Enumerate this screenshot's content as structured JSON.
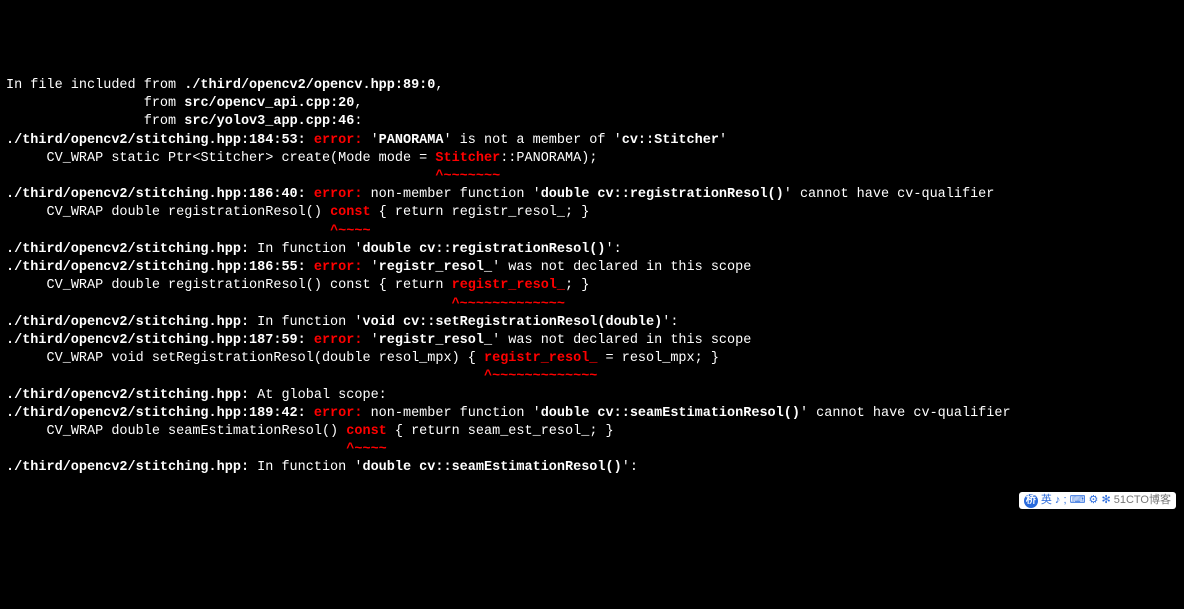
{
  "terminal": {
    "include_header": {
      "l1_a": "In file included from ",
      "l1_b": "./third/opencv2/opencv.hpp:89:0",
      "l1_c": ",",
      "l2_a": "                 from ",
      "l2_b": "src/opencv_api.cpp:20",
      "l2_c": ",",
      "l3_a": "                 from ",
      "l3_b": "src/yolov3_app.cpp:46",
      "l3_c": ":"
    },
    "err1": {
      "loc": "./third/opencv2/stitching.hpp:184:53:",
      "tag": " error: ",
      "m1": "'",
      "m2": "PANORAMA",
      "m3": "' is not a member of '",
      "m4": "cv::Stitcher",
      "m5": "'",
      "code_a": "     CV_WRAP static Ptr<Stitcher> create(Mode mode = ",
      "code_b": "Stitcher",
      "code_c": "::PANORAMA);",
      "caret": "                                                     ^~~~~~~~"
    },
    "err2": {
      "loc": "./third/opencv2/stitching.hpp:186:40:",
      "tag": " error: ",
      "m1": "non-member function '",
      "m2": "double cv::registrationResol()",
      "m3": "' cannot have cv-qualifier",
      "code_a": "     CV_WRAP double registrationResol() ",
      "code_b": "const",
      "code_c": " { return registr_resol_; }",
      "caret": "                                        ^~~~~"
    },
    "ctx1": {
      "loc": "./third/opencv2/stitching.hpp:",
      "m1": " In function '",
      "m2": "double cv::registrationResol()",
      "m3": "':"
    },
    "err3": {
      "loc": "./third/opencv2/stitching.hpp:186:55:",
      "tag": " error: ",
      "m1": "'",
      "m2": "registr_resol_",
      "m3": "' was not declared in this scope",
      "code_a": "     CV_WRAP double registrationResol() const { return ",
      "code_b": "registr_resol_",
      "code_c": "; }",
      "caret": "                                                       ^~~~~~~~~~~~~~"
    },
    "ctx2": {
      "loc": "./third/opencv2/stitching.hpp:",
      "m1": " In function '",
      "m2": "void cv::setRegistrationResol(double)",
      "m3": "':"
    },
    "err4": {
      "loc": "./third/opencv2/stitching.hpp:187:59:",
      "tag": " error: ",
      "m1": "'",
      "m2": "registr_resol_",
      "m3": "' was not declared in this scope",
      "code_a": "     CV_WRAP void setRegistrationResol(double resol_mpx) { ",
      "code_b": "registr_resol_",
      "code_c": " = resol_mpx; }",
      "caret": "                                                           ^~~~~~~~~~~~~~"
    },
    "ctx3": {
      "loc": "./third/opencv2/stitching.hpp:",
      "m1": " At global scope:"
    },
    "err5": {
      "loc": "./third/opencv2/stitching.hpp:189:42:",
      "tag": " error: ",
      "m1": "non-member function '",
      "m2": "double cv::seamEstimationResol()",
      "m3": "' cannot have cv-qualifier",
      "code_a": "     CV_WRAP double seamEstimationResol() ",
      "code_b": "const",
      "code_c": " { return seam_est_resol_; }",
      "caret": "                                          ^~~~~"
    },
    "ctx4": {
      "loc": "./third/opencv2/stitching.hpp:",
      "m1": " In function '",
      "m2": "double cv::seamEstimationResol()",
      "m3": "':"
    }
  },
  "watermark": {
    "text": "51CTO博客",
    "icon_text": "英 ♪ ; ⌨ ⚙ ✻"
  }
}
